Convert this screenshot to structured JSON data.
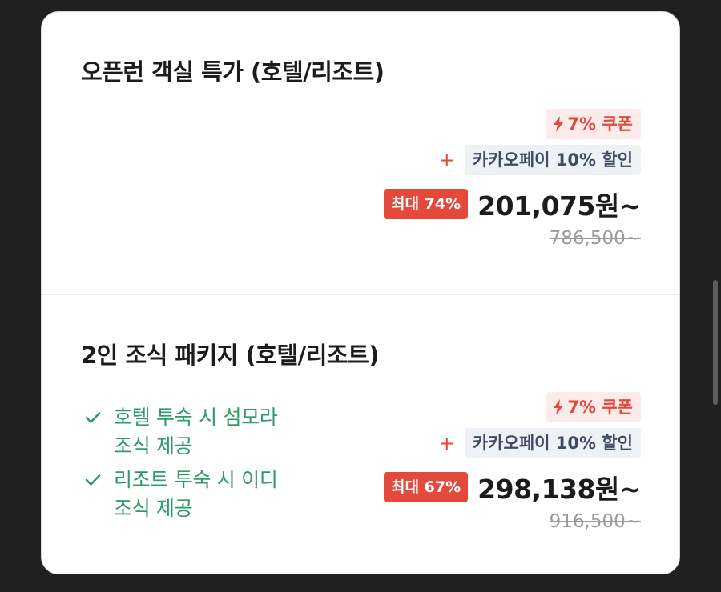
{
  "offers": [
    {
      "title": "오픈런 객실 특가 (호텔/리조트)",
      "coupon": "7% 쿠폰",
      "plus": "+",
      "pay_discount": "카카오페이 10% 할인",
      "max_discount": "최대 74%",
      "price": "201,075원~",
      "original_price": "786,500~"
    },
    {
      "title": "2인 조식 패키지 (호텔/리조트)",
      "benefits": [
        "호텔 투숙 시 섬모라 조식 제공",
        "리조트 투숙 시 이디 조식 제공"
      ],
      "coupon": "7% 쿠폰",
      "plus": "+",
      "pay_discount": "카카오페이 10% 할인",
      "max_discount": "최대 67%",
      "price": "298,138원~",
      "original_price": "916,500~"
    }
  ],
  "colors": {
    "accent_red": "#e5493b",
    "coupon_bg": "#fdebea",
    "pay_bg": "#eef1f6",
    "benefit_green": "#2f9a6c"
  },
  "icons": {
    "coupon": "lightning-bolt-icon",
    "benefit": "check-icon"
  }
}
